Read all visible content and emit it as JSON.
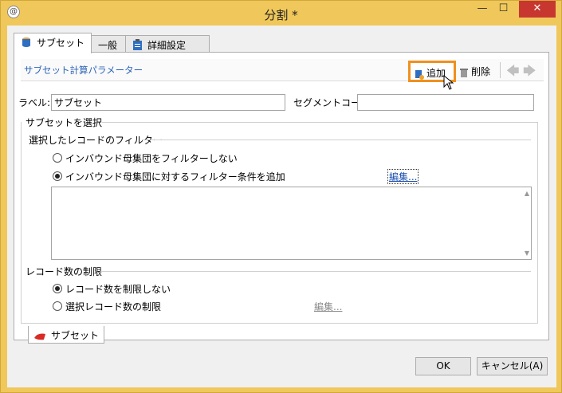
{
  "window": {
    "title": "分割 *",
    "min_glyph": "—",
    "max_glyph": "☐",
    "close_glyph": "✕"
  },
  "tabs": [
    {
      "label": "サブセット",
      "icon": "database-icon"
    },
    {
      "label": "一般"
    },
    {
      "label": "詳細設定",
      "icon": "clipboard-icon"
    }
  ],
  "toolbar": {
    "title": "サブセット計算パラメーター",
    "add_label": "追加",
    "delete_label": "削除",
    "prev_glyph": "🡄",
    "next_glyph": "🡆"
  },
  "form": {
    "label_caption": "ラベル:",
    "label_value": "サブセット",
    "segment_caption": "セグメントコード:",
    "segment_value": ""
  },
  "select_subset": {
    "header": "サブセットを選択",
    "filter_header": "選択したレコードのフィルター",
    "opt_no_filter": "インバウンド母集団をフィルターしない",
    "opt_add_filter": "インバウンド母集団に対するフィルター条件を追加",
    "edit_link": "編集..."
  },
  "limit": {
    "header": "レコード数の制限",
    "opt_no_limit": "レコード数を制限しない",
    "opt_limit": "選択レコード数の制限",
    "edit_link": "編集..."
  },
  "bottom_tab": {
    "label": "サブセット"
  },
  "buttons": {
    "ok": "OK",
    "cancel": "キャンセル(A)"
  },
  "colors": {
    "title_bar": "#f0c75a",
    "close_button": "#c7372f",
    "highlight_border": "#f0901e",
    "link": "#1a4fb0",
    "toolbar_title": "#2b63b8"
  }
}
